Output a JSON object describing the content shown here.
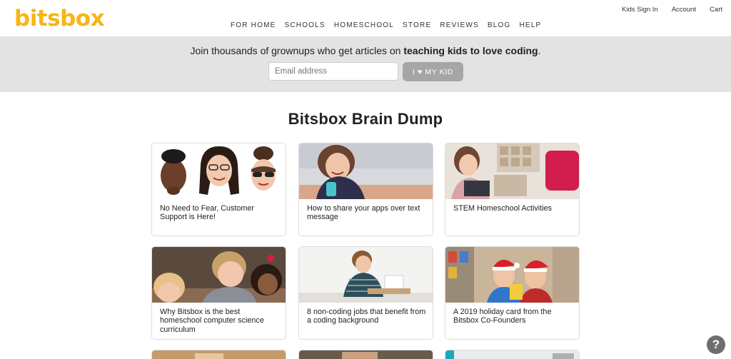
{
  "brand": {
    "logo_text": "bitsbox"
  },
  "top_nav": [
    {
      "label": "Kids Sign In"
    },
    {
      "label": "Account"
    },
    {
      "label": "Cart"
    }
  ],
  "main_nav": [
    {
      "label": "FOR HOME"
    },
    {
      "label": "SCHOOLS"
    },
    {
      "label": "HOMESCHOOL"
    },
    {
      "label": "STORE"
    },
    {
      "label": "REVIEWS"
    },
    {
      "label": "BLOG"
    },
    {
      "label": "HELP"
    }
  ],
  "signup": {
    "text_before": "Join thousands of grownups who get articles on ",
    "text_bold": "teaching kids to love coding",
    "text_after": ".",
    "email_placeholder": "Email address",
    "button_label": "I ♥ MY KID"
  },
  "page": {
    "title": "Bitsbox Brain Dump"
  },
  "articles": [
    {
      "caption": "No Need to Fear, Customer Support is Here!"
    },
    {
      "caption": "How to share your apps over text message"
    },
    {
      "caption": "STEM Homeschool Activities"
    },
    {
      "caption": "Why Bitsbox is the best homeschool computer science curriculum"
    },
    {
      "caption": "8 non-coding jobs that benefit from a coding background"
    },
    {
      "caption": "A 2019 holiday card from the Bitsbox Co-Founders"
    }
  ],
  "help": {
    "icon": "question-mark-icon",
    "glyph": "?"
  },
  "colors": {
    "brand_yellow": "#f7b515",
    "band_gray": "#e3e3e3",
    "button_gray": "#a6a6a6"
  }
}
